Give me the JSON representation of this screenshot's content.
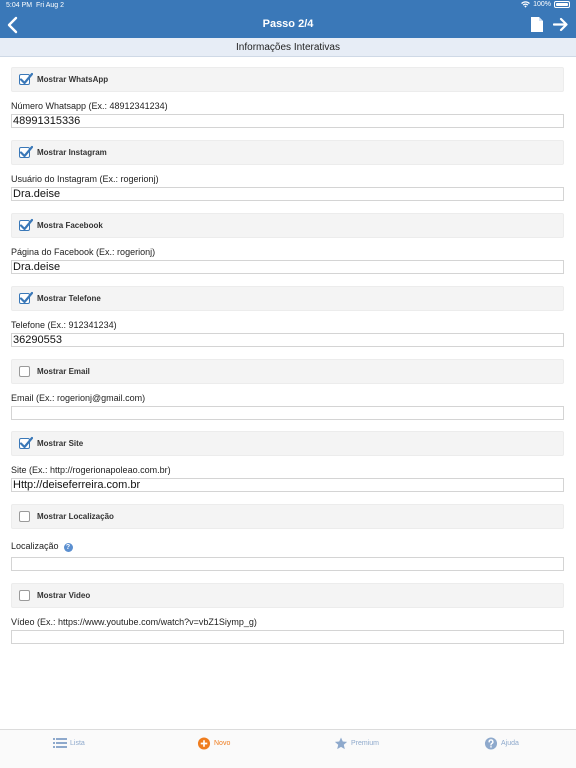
{
  "status_bar": {
    "time": "5:04 PM",
    "date": "Fri Aug 2",
    "battery": "100%"
  },
  "nav": {
    "title": "Passo 2/4",
    "back_icon": "chevron-left-icon",
    "doc_icon": "document-icon",
    "next_icon": "arrow-right-icon"
  },
  "section": {
    "title": "Informações Interativas"
  },
  "fields": [
    {
      "toggle_label": "Mostrar WhatsApp",
      "checked": true,
      "label": "Número Whatsapp (Ex.: 48912341234)",
      "value": "48991315336"
    },
    {
      "toggle_label": "Mostrar Instagram",
      "checked": true,
      "label": "Usuário do Instagram (Ex.: rogerionj)",
      "value": "Dra.deise"
    },
    {
      "toggle_label": "Mostra Facebook",
      "checked": true,
      "label": "Página do Facebook (Ex.: rogerionj)",
      "value": "Dra.deise"
    },
    {
      "toggle_label": "Mostrar Telefone",
      "checked": true,
      "label": "Telefone (Ex.: 912341234)",
      "value": "36290553"
    },
    {
      "toggle_label": "Mostrar Email",
      "checked": false,
      "label": "Email (Ex.: rogerionj@gmail.com)",
      "value": ""
    },
    {
      "toggle_label": "Mostrar Site",
      "checked": true,
      "label": "Site (Ex.: http://rogerionapoleao.com.br)",
      "value": "Http://deiseferreira.com.br"
    },
    {
      "toggle_label": "Mostrar Localização",
      "checked": false,
      "label": "Localização",
      "value": ""
    },
    {
      "toggle_label": "Mostrar Video",
      "checked": false,
      "label": "Vídeo (Ex.: https://www.youtube.com/watch?v=vbZ1Siymp_g)",
      "value": ""
    }
  ],
  "tabs": [
    {
      "label": "Lista",
      "icon": "list-icon"
    },
    {
      "label": "Novo",
      "icon": "plus-circle-icon",
      "active": true
    },
    {
      "label": "Premium",
      "icon": "star-icon"
    },
    {
      "label": "Ajuda",
      "icon": "help-circle-icon"
    }
  ],
  "colors": {
    "accent": "#3a78b8",
    "active_tab": "#ef7d1f",
    "inactive_tab": "#8ea9cc"
  }
}
